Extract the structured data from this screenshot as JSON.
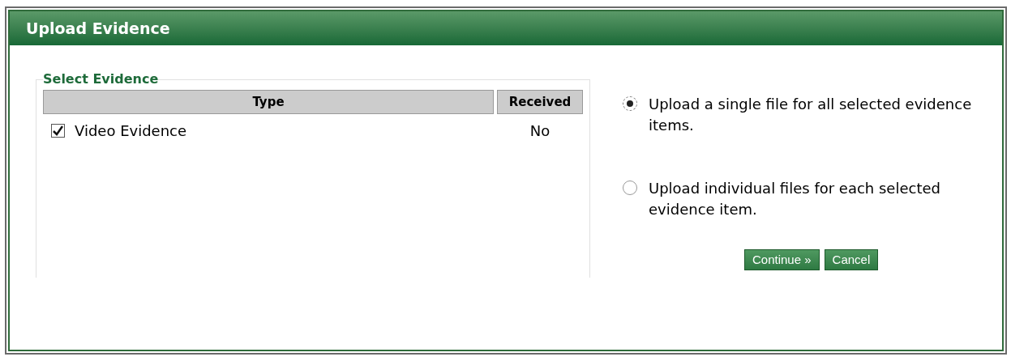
{
  "window": {
    "title": "Upload Evidence"
  },
  "evidence": {
    "legend": "Select Evidence",
    "columns": [
      "Type",
      "Received"
    ],
    "rows": [
      {
        "type": "Video Evidence",
        "received": "No",
        "checked": true
      }
    ]
  },
  "options": [
    {
      "label": "Upload a single file for all selected evidence items.",
      "selected": true
    },
    {
      "label": "Upload individual files for each selected evidence item.",
      "selected": false
    }
  ],
  "buttons": [
    "Continue »",
    "Cancel"
  ]
}
